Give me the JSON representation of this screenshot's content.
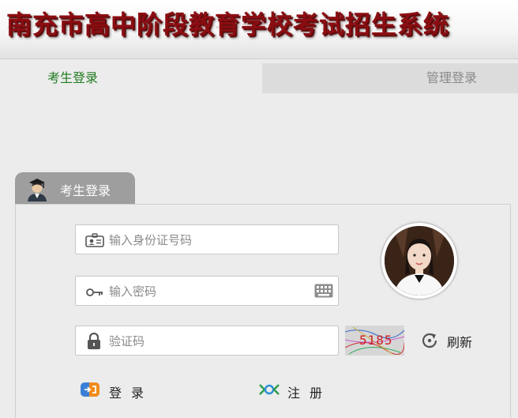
{
  "header": {
    "title": "南充市高中阶段教育学校考试招生系统"
  },
  "tabs": {
    "student": "考生登录",
    "admin": "管理登录"
  },
  "login": {
    "tab_label": "考生登录",
    "id_placeholder": "输入身份证号码",
    "password_placeholder": "输入密码",
    "captcha_placeholder": "验证码",
    "captcha_text": "5185",
    "refresh_label": "刷新",
    "login_label": "登录",
    "register_label": "注册"
  },
  "colors": {
    "title": "#8b0d12",
    "active_tab": "#1f7a1f",
    "inactive_tab_bg": "#dcdcdc",
    "login_tab_bg": "#9e9e9e",
    "page_bg": "#ececec"
  },
  "icons": {
    "student": "student-avatar-icon",
    "id_card": "id-card-icon",
    "key": "key-icon",
    "keyboard": "keyboard-icon",
    "lock": "lock-icon",
    "refresh": "refresh-icon",
    "login": "login-icon",
    "register": "register-icon"
  }
}
